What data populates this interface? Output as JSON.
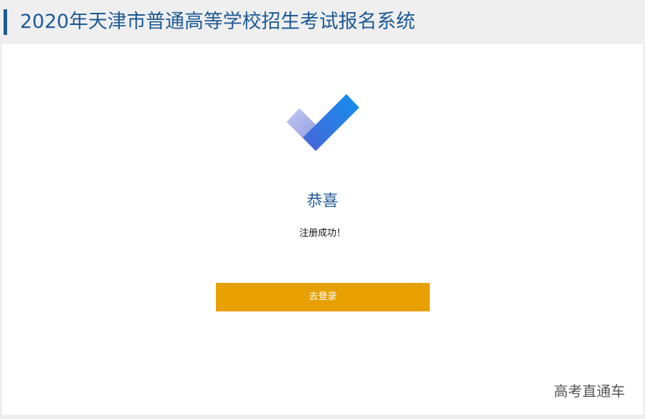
{
  "header": {
    "title": "2020年天津市普通高等学校招生考试报名系统"
  },
  "result": {
    "icon": "checkmark-icon",
    "title": "恭喜",
    "message": "注册成功！"
  },
  "actions": {
    "login_label": "去登录"
  },
  "watermark": {
    "text": "高考直通车"
  },
  "colors": {
    "accent": "#1d5a94",
    "button": "#e8a000",
    "check_light": "#b3b9ec",
    "check_dark": "#1e8aeb"
  }
}
